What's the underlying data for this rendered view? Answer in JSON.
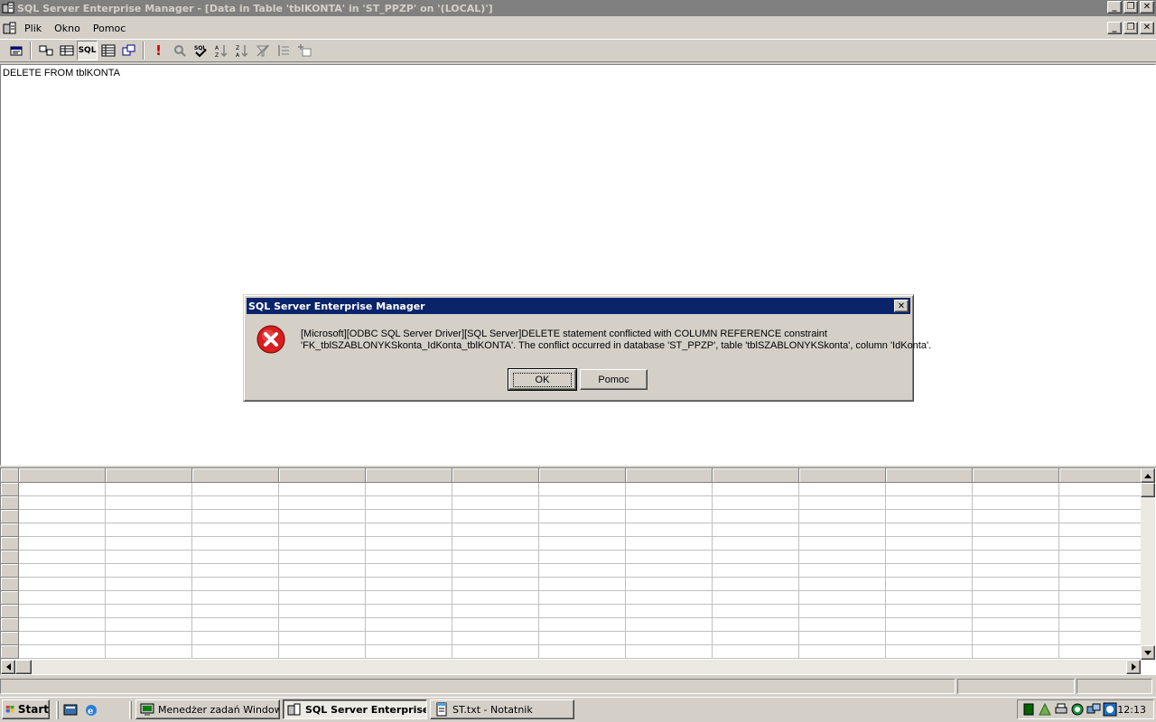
{
  "window": {
    "title": "SQL Server Enterprise Manager - [Data in Table 'tblKONTA' in 'ST_PPZP' on '(LOCAL)']",
    "minimize_glyph": "_",
    "restore_glyph": "❐",
    "close_glyph": "✕"
  },
  "menu": {
    "items": [
      {
        "label": "Plik",
        "icon": "file-menu"
      },
      {
        "label": "Okno",
        "icon": "window-menu"
      },
      {
        "label": "Pomoc",
        "icon": "help-menu"
      }
    ]
  },
  "toolbar": {
    "buttons": [
      "properties-icon",
      "diagram-pane-icon",
      "grid-pane-icon",
      "sql-pane-icon",
      "results-pane-icon",
      "change-type-icon",
      "run-icon",
      "verify-sql-icon",
      "remove-filter-icon",
      "sort-ascending-icon",
      "sort-descending-icon",
      "remove-filter-icon",
      "group-by-icon",
      "add-table-icon"
    ],
    "sql_pane_label": "SQL",
    "run_glyph": "!"
  },
  "sql_pane": {
    "text": "DELETE FROM tblKONTA"
  },
  "grid": {
    "column_count": 13,
    "row_count": 13
  },
  "dialog": {
    "title": "SQL Server Enterprise Manager",
    "icon": "error-icon",
    "message_line1": "[Microsoft][ODBC SQL Server Driver][SQL Server]DELETE statement conflicted with COLUMN REFERENCE constraint",
    "message_line2": "'FK_tblSZABLONYKSkonta_IdKonta_tblKONTA'. The conflict occurred in database 'ST_PPZP', table 'tblSZABLONYKSkonta', column 'IdKonta'.",
    "ok_label": "OK",
    "help_label": "Pomoc",
    "close_glyph": "✕"
  },
  "taskbar": {
    "start_label": "Start",
    "tasks": [
      {
        "label": "Menedżer zadań Windows",
        "icon": "task-manager-icon",
        "active": false
      },
      {
        "label": "SQL Server Enterprise...",
        "icon": "enterprise-manager-icon",
        "active": true
      },
      {
        "label": "ST.txt - Notatnik",
        "icon": "notepad-icon",
        "active": false
      }
    ],
    "clock": "12:13"
  },
  "colors": {
    "desktop_face": "#d4d0c8",
    "active_title": "#0a246a",
    "inactive_title": "#808080",
    "error_red": "#d81e1e"
  }
}
